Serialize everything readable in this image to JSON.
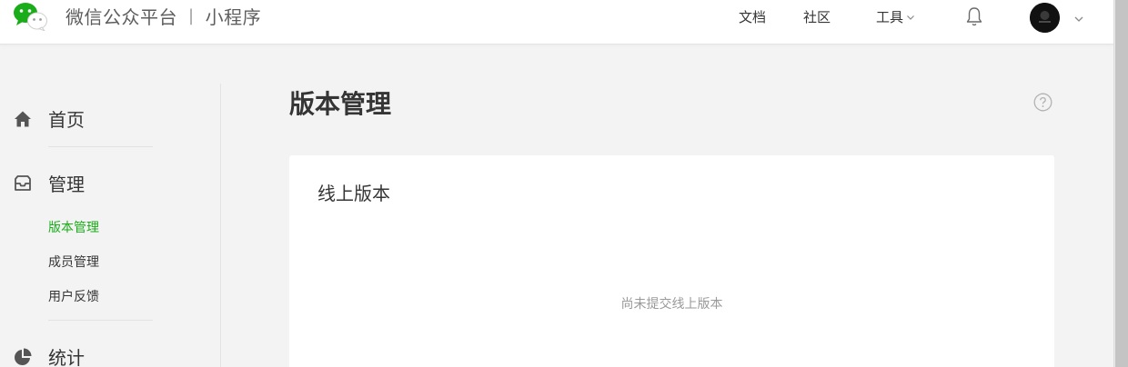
{
  "header": {
    "brand_title": "微信公众平台",
    "brand_separator": "|",
    "brand_subtitle": "小程序",
    "nav": {
      "docs": "文档",
      "community": "社区",
      "tools": "工具"
    }
  },
  "sidebar": {
    "sections": [
      {
        "label": "首页",
        "icon": "home-icon"
      },
      {
        "label": "管理",
        "icon": "inbox-icon"
      },
      {
        "label": "统计",
        "icon": "pie-chart-icon"
      }
    ],
    "manage_items": [
      {
        "label": "版本管理",
        "active": true
      },
      {
        "label": "成员管理",
        "active": false
      },
      {
        "label": "用户反馈",
        "active": false
      }
    ]
  },
  "main": {
    "page_title": "版本管理",
    "card": {
      "title": "线上版本",
      "empty_text": "尚未提交线上版本"
    }
  },
  "colors": {
    "accent_green": "#1aad19",
    "text_primary": "#353535",
    "text_muted": "#9a9a9a",
    "page_bg": "#f3f3f3"
  }
}
